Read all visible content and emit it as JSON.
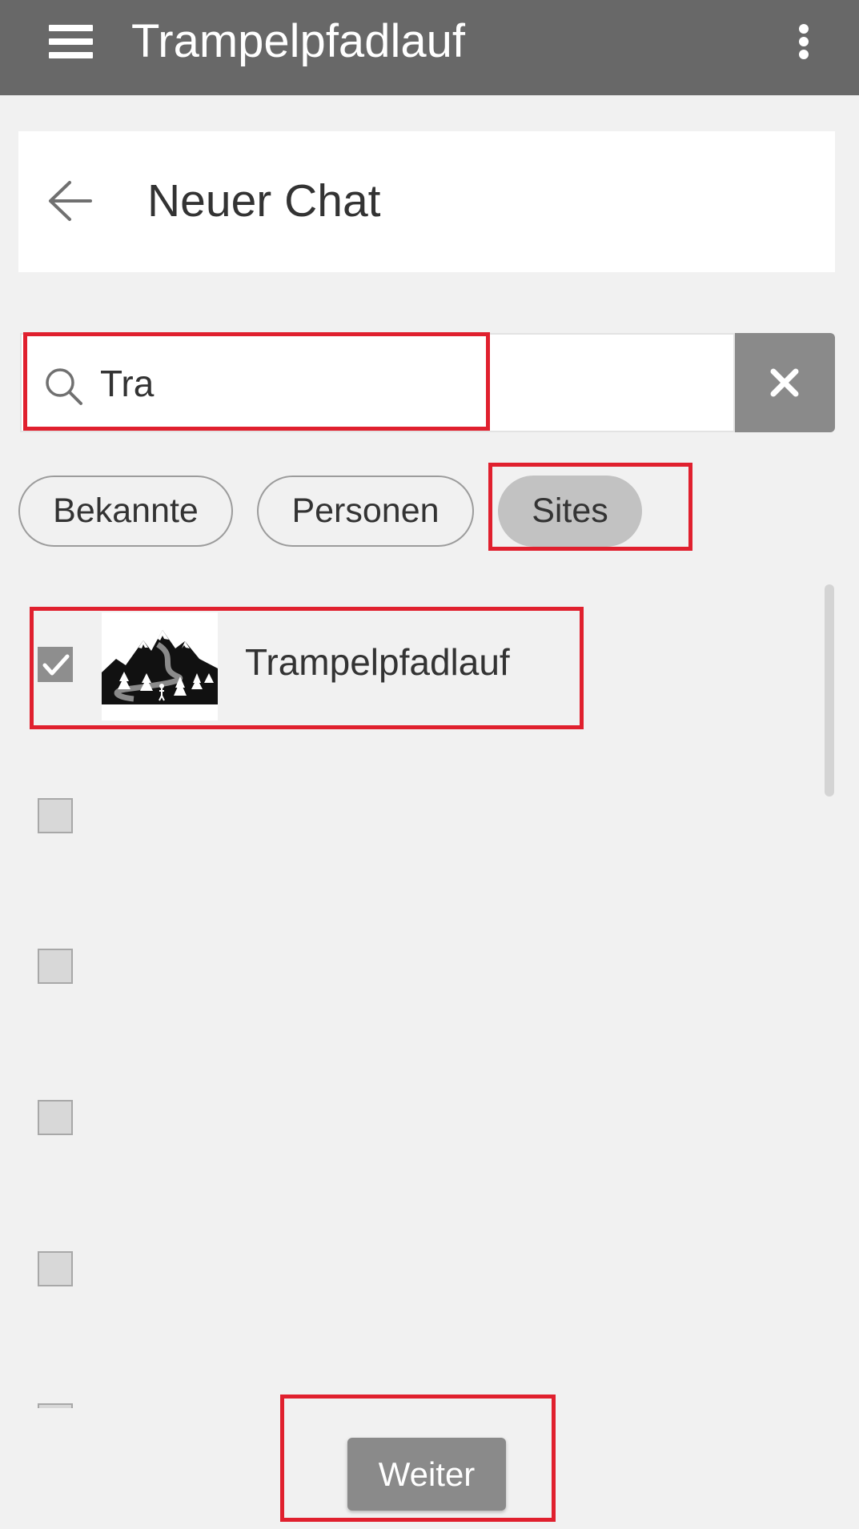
{
  "appbar": {
    "title": "Trampelpfadlauf",
    "menu_icon": "hamburger-menu-icon",
    "overflow_icon": "more-vert-icon",
    "background": "#686868"
  },
  "header": {
    "title": "Neuer Chat",
    "back_icon": "arrow-left-icon"
  },
  "search": {
    "value": "Tra",
    "icon": "search-icon",
    "clear_icon": "close-icon"
  },
  "filters": {
    "chips": [
      {
        "label": "Bekannte",
        "selected": false
      },
      {
        "label": "Personen",
        "selected": false
      },
      {
        "label": "Sites",
        "selected": true
      }
    ]
  },
  "results": {
    "items": [
      {
        "name": "Trampelpfadlauf",
        "checked": true,
        "thumbnail": "mountain-forest-logo"
      },
      {
        "name": "",
        "checked": false
      },
      {
        "name": "",
        "checked": false
      },
      {
        "name": "",
        "checked": false
      },
      {
        "name": "",
        "checked": false
      }
    ]
  },
  "footer": {
    "next_label": "Weiter"
  },
  "highlight_color": "#e0202e"
}
